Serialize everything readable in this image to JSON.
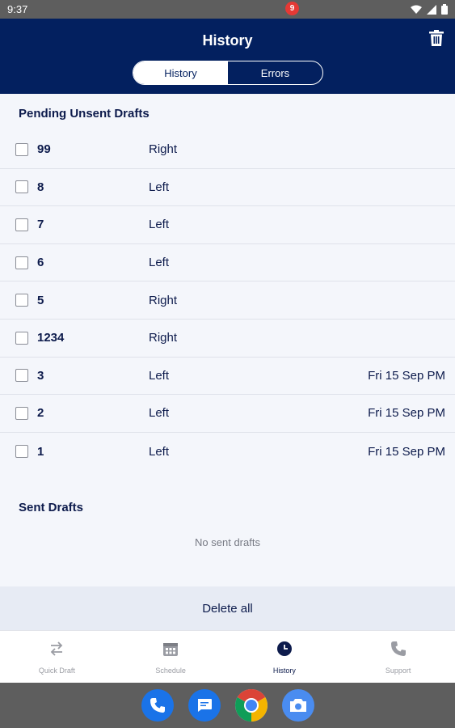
{
  "status_bar": {
    "time": "9:37"
  },
  "header": {
    "title": "History",
    "tabs": [
      {
        "label": "History",
        "active": true
      },
      {
        "label": "Errors",
        "active": false
      }
    ]
  },
  "pending": {
    "title": "Pending Unsent Drafts",
    "rows": [
      {
        "number": "99",
        "side": "Right",
        "date": ""
      },
      {
        "number": "8",
        "side": "Left",
        "date": ""
      },
      {
        "number": "7",
        "side": "Left",
        "date": ""
      },
      {
        "number": "6",
        "side": "Left",
        "date": ""
      },
      {
        "number": "5",
        "side": "Right",
        "date": ""
      },
      {
        "number": "1234",
        "side": "Right",
        "date": ""
      },
      {
        "number": "3",
        "side": "Left",
        "date": "Fri 15 Sep PM"
      },
      {
        "number": "2",
        "side": "Left",
        "date": "Fri 15 Sep PM"
      },
      {
        "number": "1",
        "side": "Left",
        "date": "Fri 15 Sep PM"
      }
    ]
  },
  "sent": {
    "title": "Sent Drafts",
    "empty_message": "No sent drafts"
  },
  "delete_all_label": "Delete all",
  "bottom_nav": {
    "items": [
      {
        "label": "Quick Draft",
        "icon": "swap-arrows-icon",
        "active": false
      },
      {
        "label": "Schedule",
        "icon": "calendar-icon",
        "active": false
      },
      {
        "label": "History",
        "icon": "clock-icon",
        "active": true,
        "badge": "9"
      },
      {
        "label": "Support",
        "icon": "phone-icon",
        "active": false
      }
    ]
  },
  "colors": {
    "header_bg": "#03205f",
    "text_primary": "#0d1b4c",
    "badge": "#e53935",
    "status_bar": "#5e5e5e"
  },
  "dock": [
    "phone-app-icon",
    "messages-app-icon",
    "chrome-app-icon",
    "camera-app-icon"
  ]
}
